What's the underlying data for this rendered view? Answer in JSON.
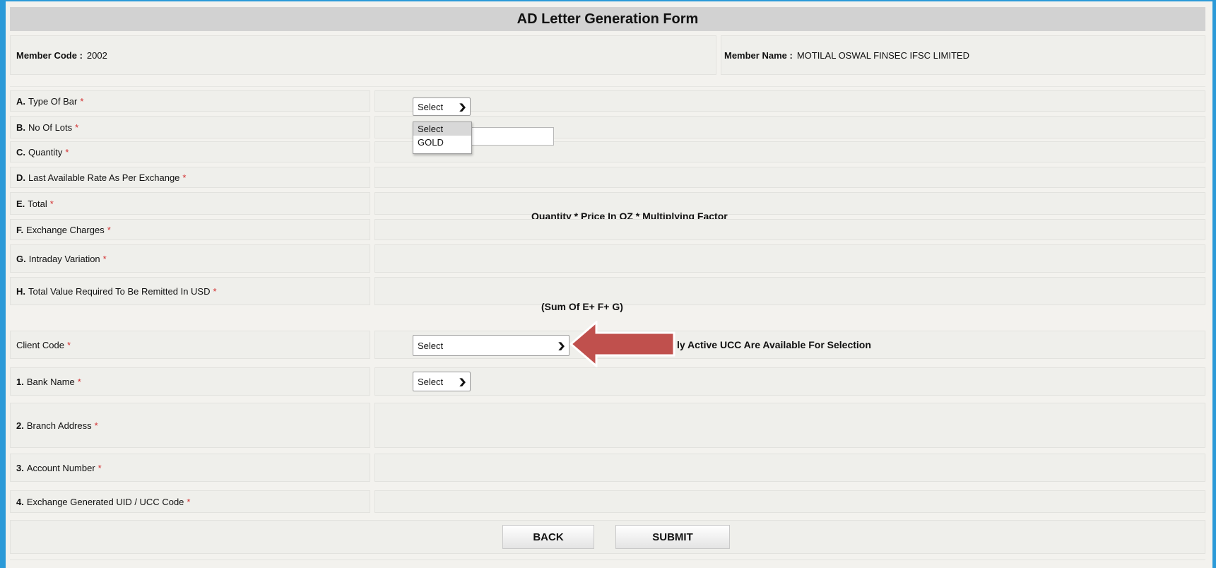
{
  "form_title": "AD Letter Generation Form",
  "member": {
    "code_label": "Member Code :",
    "code_value": "2002",
    "name_label": "Member Name :",
    "name_value": "MOTILAL OSWAL FINSEC IFSC LIMITED"
  },
  "rows": {
    "type_of_bar": {
      "prefix": "A.",
      "label": "Type Of Bar",
      "select_value": "Select"
    },
    "no_of_lots": {
      "prefix": "B.",
      "label": "No Of Lots"
    },
    "quantity": {
      "prefix": "C.",
      "label": "Quantity"
    },
    "last_rate": {
      "prefix": "D.",
      "label": "Last Available Rate As Per Exchange"
    },
    "total": {
      "prefix": "E.",
      "label": "Total",
      "formula": "Quantity * Price In OZ * Multiplying Factor"
    },
    "exchange_charges": {
      "prefix": "F.",
      "label": "Exchange Charges"
    },
    "intraday_variation": {
      "prefix": "G.",
      "label": "Intraday Variation"
    },
    "total_value_usd": {
      "prefix": "H.",
      "label": "Total Value Required To Be Remitted In USD",
      "formula": "(Sum Of E+ F+ G)"
    },
    "client_code": {
      "label": "Client Code",
      "select_value": "Select",
      "note": "ly Active UCC Are Available For Selection"
    },
    "bank_name": {
      "prefix": "1.",
      "label": "Bank Name",
      "select_value": "Select"
    },
    "branch_address": {
      "prefix": "2.",
      "label": "Branch Address"
    },
    "account_number": {
      "prefix": "3.",
      "label": "Account Number"
    },
    "uid_ucc": {
      "prefix": "4.",
      "label": "Exchange Generated UID / UCC Code"
    }
  },
  "required_marker": "*",
  "type_of_bar_options": [
    "Select",
    "GOLD"
  ],
  "buttons": {
    "back": "BACK",
    "submit": "SUBMIT"
  },
  "colors": {
    "arrow": "#c0504d",
    "header_bg": "#d2d2d2",
    "frame_border": "#2b9ad8"
  }
}
